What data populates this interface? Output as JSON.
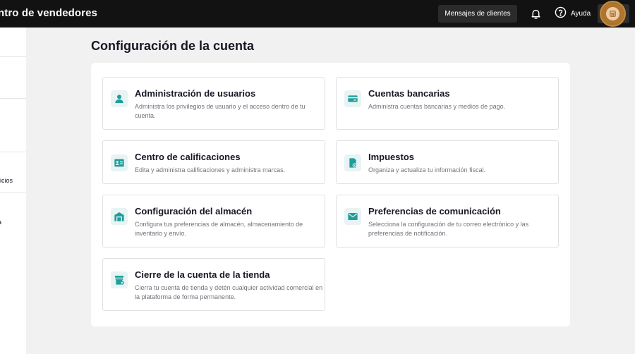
{
  "header": {
    "app_title": "ntro de vendedores",
    "messages_button": "Mensajes de clientes",
    "help_label": "Ayuda"
  },
  "sidebar": {
    "partial_texts": [
      "icios",
      "a"
    ]
  },
  "page": {
    "title": "Configuración de la cuenta"
  },
  "cards": [
    {
      "title": "Administración de usuarios",
      "description": "Administra los privilegios de usuario y el acceso dentro de tu cuenta.",
      "icon": "user-icon"
    },
    {
      "title": "Cuentas bancarias",
      "description": "Administra cuentas bancarias y medios de pago.",
      "icon": "bank-card-icon"
    },
    {
      "title": "Centro de calificaciones",
      "description": "Edita y administra calificaciones y administra marcas.",
      "icon": "id-card-icon"
    },
    {
      "title": "Impuestos",
      "description": "Organiza y actualiza tu información fiscal.",
      "icon": "tax-document-icon"
    },
    {
      "title": "Configuración del almacén",
      "description": "Configura tus preferencias de almacén, almacenamiento de inventario y envío.",
      "icon": "warehouse-icon"
    },
    {
      "title": "Preferencias de comunicación",
      "description": "Selecciona la configuración de tu correo electrónico y las preferencias de notificación.",
      "icon": "envelope-icon"
    },
    {
      "title": "Cierre de la cuenta de la tienda",
      "description": "Cierra tu cuenta de tienda y detén cualquier actividad comercial en la plataforma de forma permanente.",
      "icon": "close-store-icon"
    }
  ],
  "colors": {
    "topbar": "#121212",
    "accent_teal": "#1f9e9a",
    "highlight_ring": "#c7893a"
  }
}
